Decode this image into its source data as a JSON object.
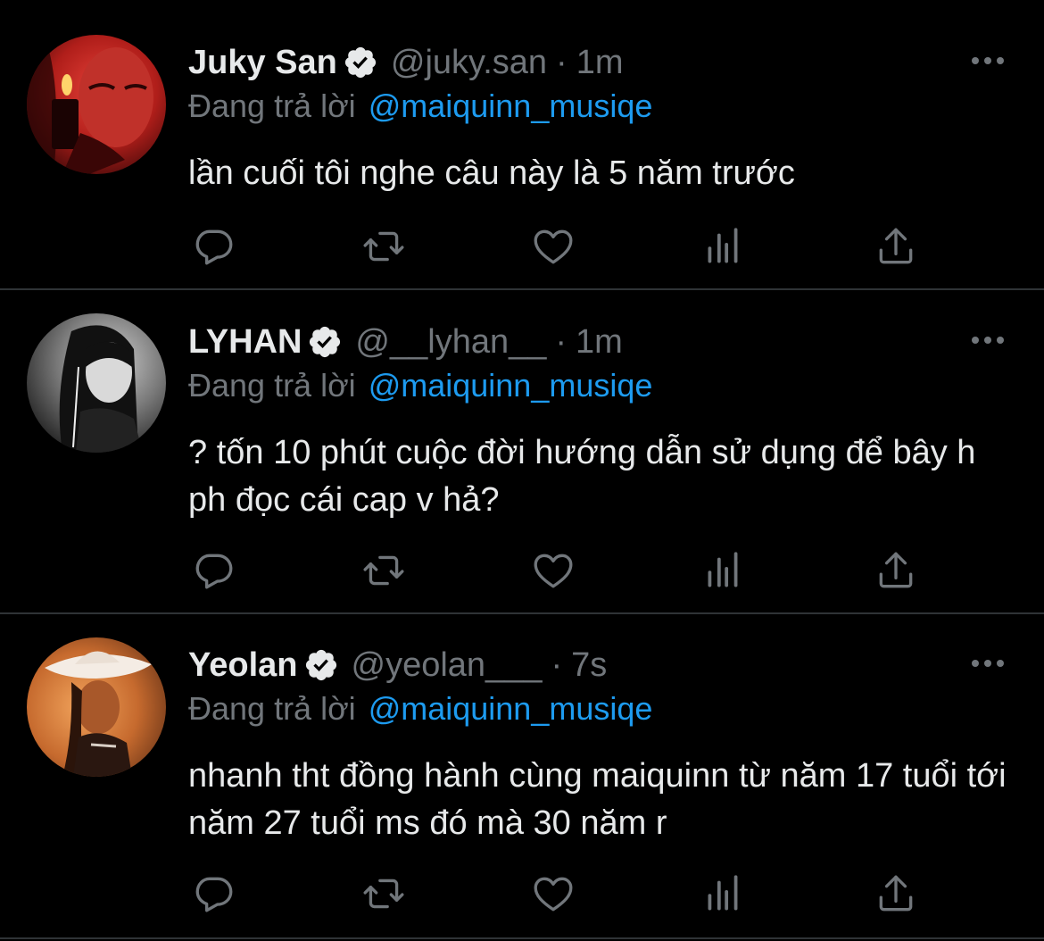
{
  "reply_prefix": "Đang trả lời",
  "tweets": [
    {
      "name": "Juky San",
      "handle": "@juky.san",
      "time": "1m",
      "reply_to": "@maiquinn_musiqe",
      "text": "lần cuối tôi nghe câu này là 5 năm trước",
      "avatar_style": "red-toned portrait"
    },
    {
      "name": "LYHAN",
      "handle": "@__lyhan__",
      "time": "1m",
      "reply_to": "@maiquinn_musiqe",
      "text": "? tốn 10 phút cuộc đời hướng dẫn sử dụng để bây h ph đọc cái cap v hả?",
      "avatar_style": "black-and-white portrait"
    },
    {
      "name": "Yeolan",
      "handle": "@yeolan___",
      "time": "7s",
      "reply_to": "@maiquinn_musiqe",
      "text": "nhanh tht đồng hành cùng maiquinn từ năm 17 tuổi tới năm 27 tuổi ms đó mà 30 năm r",
      "avatar_style": "warm-toned portrait with cowboy hat"
    }
  ],
  "icons": [
    "reply-icon",
    "retweet-icon",
    "like-icon",
    "analytics-icon",
    "share-icon",
    "verified-badge-icon",
    "more-options-icon"
  ],
  "colors": {
    "background": "#000000",
    "text": "#e7e9ea",
    "secondary": "#71767b",
    "link": "#1d9bf0",
    "divider": "#2f3336"
  }
}
